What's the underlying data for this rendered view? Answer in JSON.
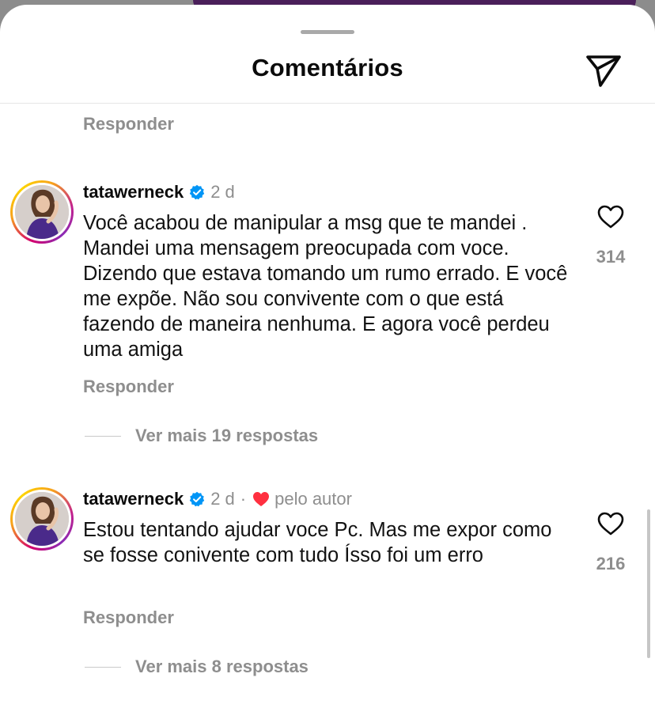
{
  "header": {
    "title": "Comentários",
    "share_icon": "paper-plane-icon"
  },
  "previous_reply_label": "Responder",
  "comments": [
    {
      "username": "tatawerneck",
      "verified": true,
      "time": "2 d",
      "liked_by_author": false,
      "text": "Você acabou de manipular a msg que te mandei . Mandei uma mensagem preocupada com voce. Dizendo que estava tomando um rumo errado. E você me expõe. Não sou convivente com o que está fazendo de maneira nenhuma. E agora você perdeu uma amiga",
      "likes": "314",
      "reply_label": "Responder",
      "more_replies": "Ver mais 19 respostas"
    },
    {
      "username": "tatawerneck",
      "verified": true,
      "time": "2 d",
      "separator": "·",
      "liked_by_author": true,
      "liked_label": "pelo autor",
      "text": "Estou tentando ajudar voce Pc. Mas me expor como se fosse conivente com tudo Ísso foi um erro",
      "likes": "216",
      "reply_label": "Responder",
      "more_replies": "Ver mais 8 respostas"
    }
  ],
  "colors": {
    "verified_blue": "#0095f6",
    "heart_red": "#ff3040",
    "muted_text": "#8e8e8e"
  }
}
